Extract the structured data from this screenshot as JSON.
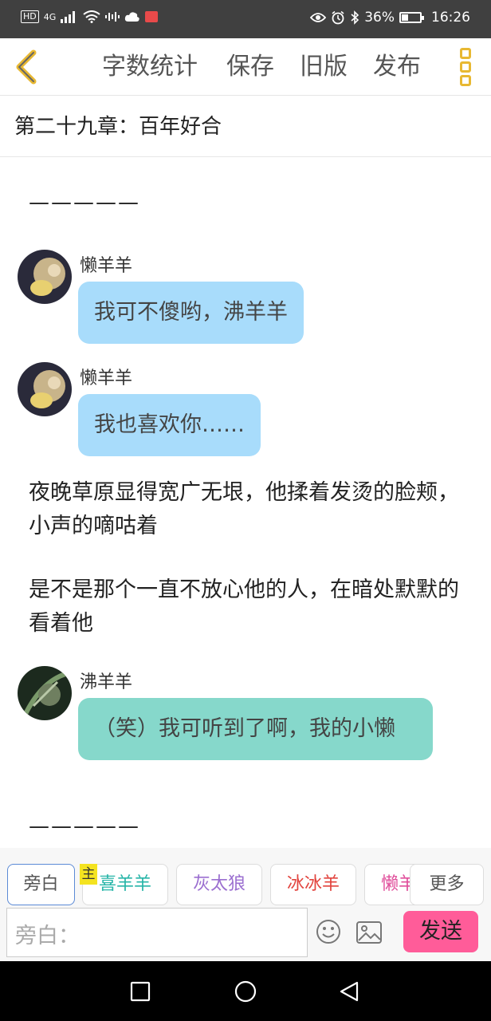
{
  "status_bar": {
    "hd": "HD",
    "signal": "4G",
    "battery": "36%",
    "battery_level": 0.36,
    "time": "16:26"
  },
  "toolbar": {
    "word_count": "字数统计",
    "save": "保存",
    "old_version": "旧版",
    "publish": "发布"
  },
  "chapter": {
    "title": "第二十九章：百年好合"
  },
  "content": {
    "separator_1": "—————",
    "separator_2": "—————",
    "messages": [
      {
        "name": "懒羊羊",
        "text": "我可不傻哟，沸羊羊",
        "color": "#a8dcfb"
      },
      {
        "name": "懒羊羊",
        "text": "我也喜欢你……",
        "color": "#a8dcfb"
      },
      {
        "name": "沸羊羊",
        "text": "（笑）我可听到了啊，我的小懒",
        "color": "#86d8cb"
      }
    ],
    "narration_1": "夜晚草原显得宽广无垠，他揉着发烫的脸颊，小声的嘀咕着",
    "narration_2": "是不是那个一直不放心他的人，在暗处默默的看着他"
  },
  "characters": {
    "main_tag": "主",
    "items": [
      {
        "label": "旁白",
        "color": "#555555"
      },
      {
        "label": "喜羊羊",
        "color": "#27b5a8"
      },
      {
        "label": "灰太狼",
        "color": "#9b6fd0"
      },
      {
        "label": "冰冰羊",
        "color": "#e2443e"
      },
      {
        "label": "懒羊羊",
        "color": "#e04f9b"
      }
    ],
    "more": "更多"
  },
  "input": {
    "placeholder": "旁白：",
    "send": "发送"
  },
  "colors": {
    "accent": "#ff5c99",
    "menu_icon": "#e8b832",
    "back_icon": "#e8b832"
  }
}
